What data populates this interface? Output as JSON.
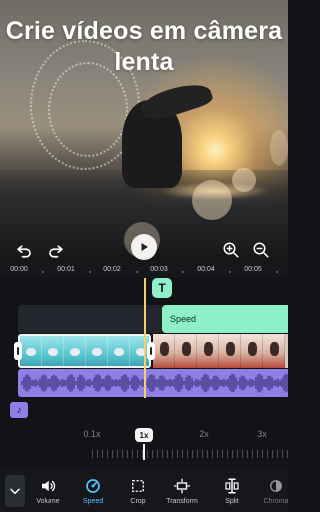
{
  "headline": "Crie vídeos em câmera lenta",
  "timeline": {
    "ticks": [
      "00:00",
      "00:01",
      "00:02",
      "00:03",
      "00:04",
      "00:05"
    ],
    "text_marker": "T",
    "speed_track_label": "Speed",
    "audio_badge": "♪"
  },
  "speed": {
    "options": [
      "0.1x",
      "1x",
      "2x",
      "3x"
    ],
    "current": "1x"
  },
  "toolbar": {
    "items": [
      {
        "label": "Volume",
        "icon": "volume-icon"
      },
      {
        "label": "Speed",
        "icon": "speed-icon"
      },
      {
        "label": "Crop",
        "icon": "crop-icon"
      },
      {
        "label": "Transform",
        "icon": "transform-icon"
      },
      {
        "label": "Split",
        "icon": "split-icon"
      },
      {
        "label": "Chroma",
        "icon": "chroma-icon"
      }
    ]
  },
  "colors": {
    "accent_blue": "#58c4ff",
    "speed_track": "#8ef0c8",
    "audio_track": "#8f7ee6",
    "playhead": "#f4cf6a"
  }
}
